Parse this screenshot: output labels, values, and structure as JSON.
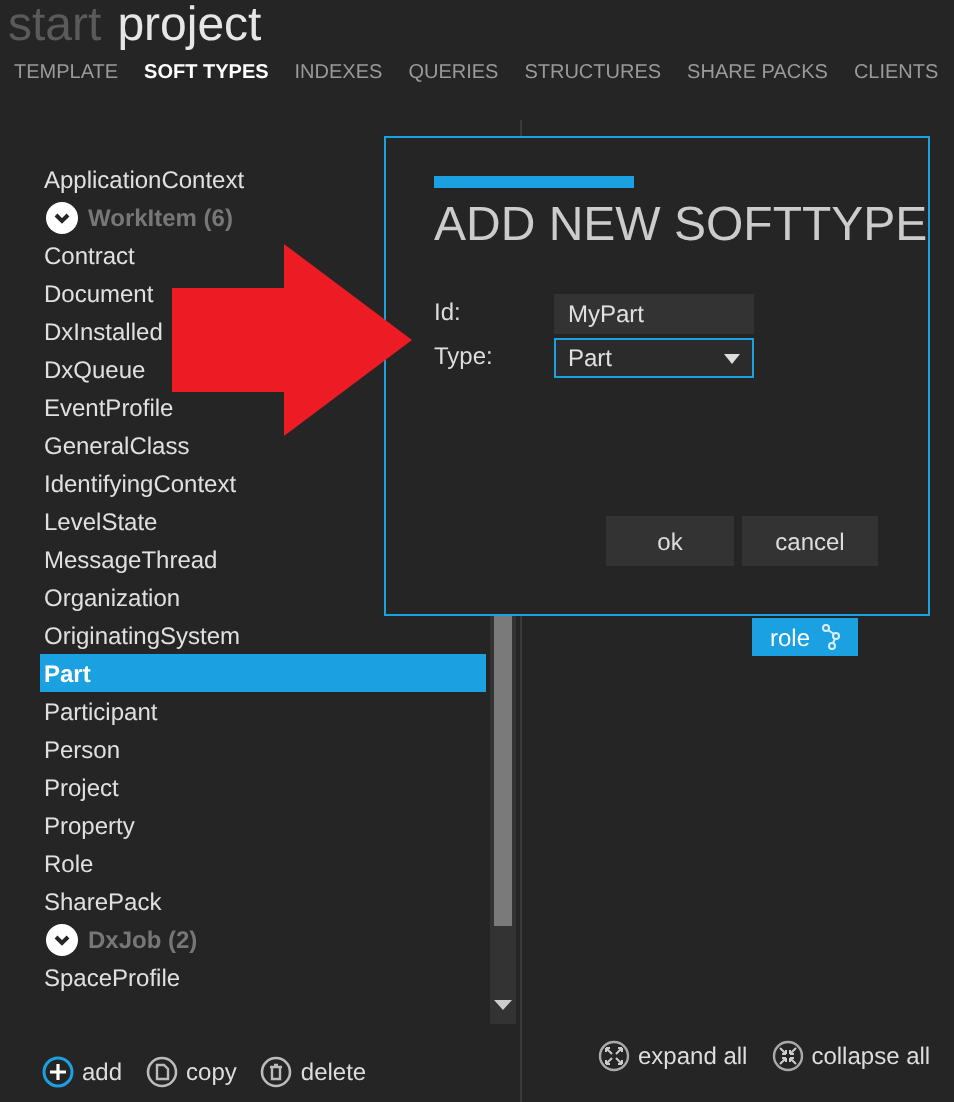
{
  "header": {
    "breadcrumb": "start",
    "title": "project"
  },
  "tabs": [
    {
      "label": "TEMPLATE",
      "selected": false
    },
    {
      "label": "SOFT TYPES",
      "selected": true
    },
    {
      "label": "INDEXES",
      "selected": false
    },
    {
      "label": "QUERIES",
      "selected": false
    },
    {
      "label": "STRUCTURES",
      "selected": false
    },
    {
      "label": "SHARE PACKS",
      "selected": false
    },
    {
      "label": "CLIENTS",
      "selected": false
    }
  ],
  "softtypes": [
    {
      "kind": "item",
      "label": "ApplicationContext",
      "selected": false
    },
    {
      "kind": "group",
      "label": "WorkItem (6)",
      "expanded": true
    },
    {
      "kind": "item",
      "label": "Contract",
      "selected": false
    },
    {
      "kind": "item",
      "label": "Document",
      "selected": false
    },
    {
      "kind": "item",
      "label": "DxInstalled",
      "selected": false
    },
    {
      "kind": "item",
      "label": "DxQueue",
      "selected": false
    },
    {
      "kind": "item",
      "label": "EventProfile",
      "selected": false
    },
    {
      "kind": "item",
      "label": "GeneralClass",
      "selected": false
    },
    {
      "kind": "item",
      "label": "IdentifyingContext",
      "selected": false
    },
    {
      "kind": "item",
      "label": "LevelState",
      "selected": false
    },
    {
      "kind": "item",
      "label": "MessageThread",
      "selected": false
    },
    {
      "kind": "item",
      "label": "Organization",
      "selected": false
    },
    {
      "kind": "item",
      "label": "OriginatingSystem",
      "selected": false
    },
    {
      "kind": "item",
      "label": "Part",
      "selected": true
    },
    {
      "kind": "item",
      "label": "Participant",
      "selected": false
    },
    {
      "kind": "item",
      "label": "Person",
      "selected": false
    },
    {
      "kind": "item",
      "label": "Project",
      "selected": false
    },
    {
      "kind": "item",
      "label": "Property",
      "selected": false
    },
    {
      "kind": "item",
      "label": "Role",
      "selected": false
    },
    {
      "kind": "item",
      "label": "SharePack",
      "selected": false
    },
    {
      "kind": "group",
      "label": "DxJob (2)",
      "expanded": true
    },
    {
      "kind": "item",
      "label": "SpaceProfile",
      "selected": false
    }
  ],
  "list_actions": [
    "add",
    "copy",
    "delete"
  ],
  "detail": {
    "chip": "role",
    "actions": [
      "expand all",
      "collapse all"
    ]
  },
  "dialog": {
    "title": "ADD NEW SOFTTYPE",
    "id_label": "Id:",
    "id_value": "MyPart",
    "type_label": "Type:",
    "type_value": "Part",
    "buttons": [
      "ok",
      "cancel"
    ]
  }
}
